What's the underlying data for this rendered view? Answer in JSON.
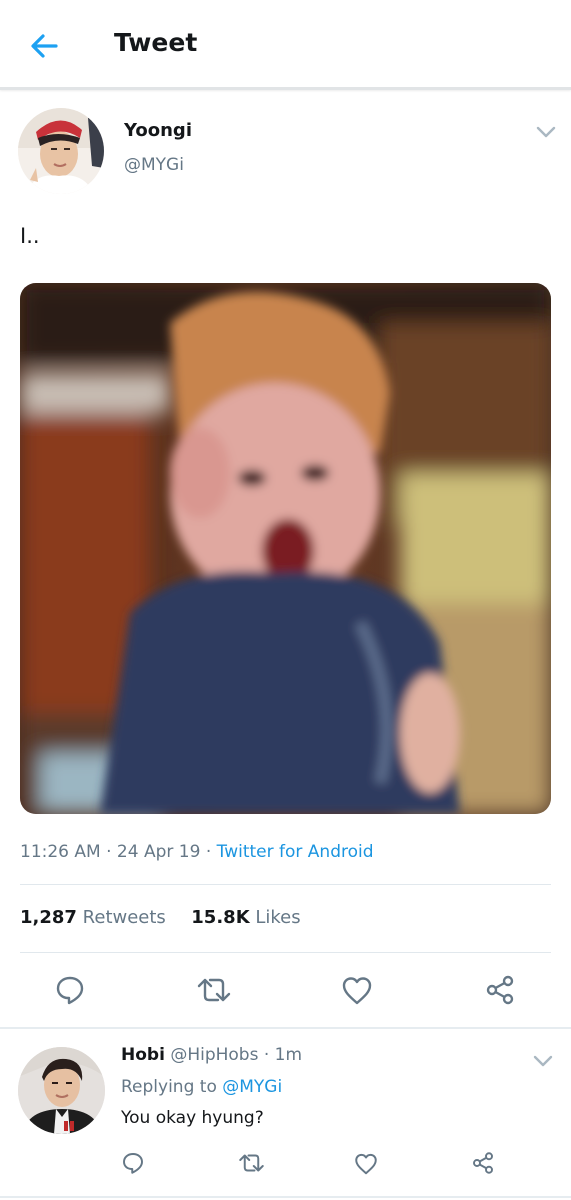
{
  "header": {
    "title": "Tweet",
    "back_icon": "arrow-left-icon",
    "accent": "#1da1f2"
  },
  "tweet": {
    "author_name": "Yoongi",
    "author_handle": "@MYGi",
    "text": "I..",
    "time": "11:26 AM",
    "date": "24 Apr 19",
    "source": "Twitter for Android",
    "retweets_count": "1,287",
    "retweets_label": "Retweets",
    "likes_count": "15.8K",
    "likes_label": "Likes",
    "media_icon": "photo-screaming-child"
  },
  "actions": {
    "reply_icon": "reply-icon",
    "retweet_icon": "retweet-icon",
    "like_icon": "heart-icon",
    "share_icon": "share-icon"
  },
  "reply": {
    "author_name": "Hobi",
    "author_handle": "@HipHobs",
    "time": "1m",
    "replying_to_label": "Replying to",
    "replying_to_handle": "@MYGi",
    "text": "You okay hyung?"
  },
  "colors": {
    "text_primary": "#14171a",
    "text_secondary": "#657786",
    "link": "#1b95e0",
    "divider": "#e1e8ed"
  }
}
